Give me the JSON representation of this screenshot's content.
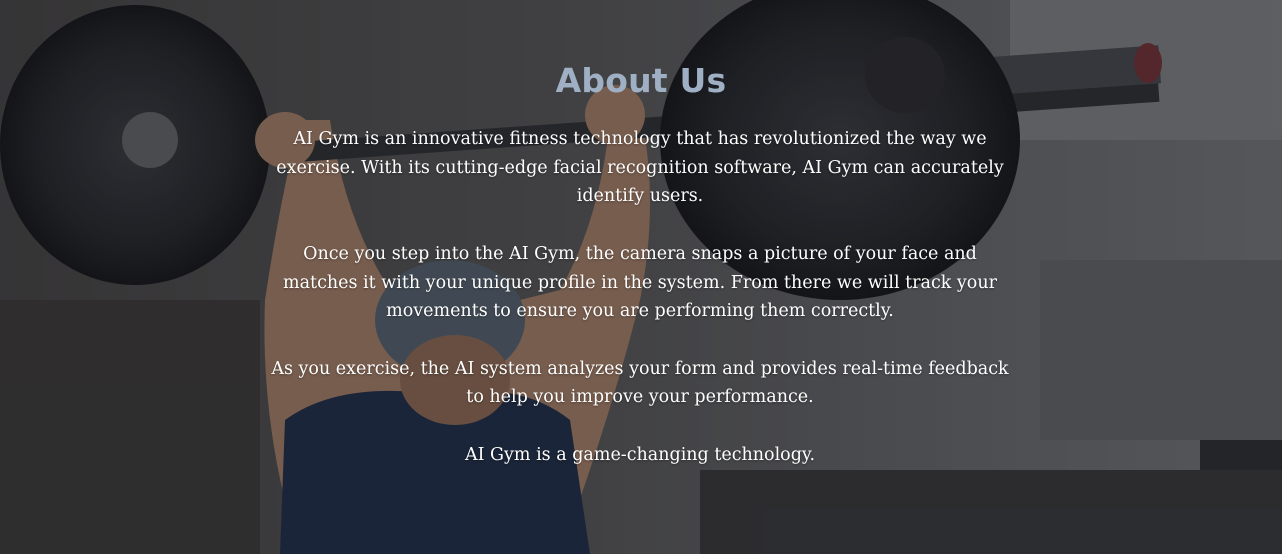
{
  "about": {
    "title": "About Us",
    "paragraphs": [
      "AI Gym is an innovative fitness technology that has revolutionized the way we exercise. With its cutting-edge facial recognition software, AI Gym can accurately identify users.",
      "Once you step into the AI Gym, the camera snaps a picture of your face and matches it with your unique profile in the system. From there we will track your movements to ensure you are performing them correctly.",
      "As you exercise, the AI system analyzes your form and provides real-time feedback to help you improve your performance.",
      "AI Gym is a game-changing technology."
    ]
  },
  "colors": {
    "title": "#9fb0c4",
    "body_text": "#ffffff",
    "background": "#3a3c3e"
  }
}
